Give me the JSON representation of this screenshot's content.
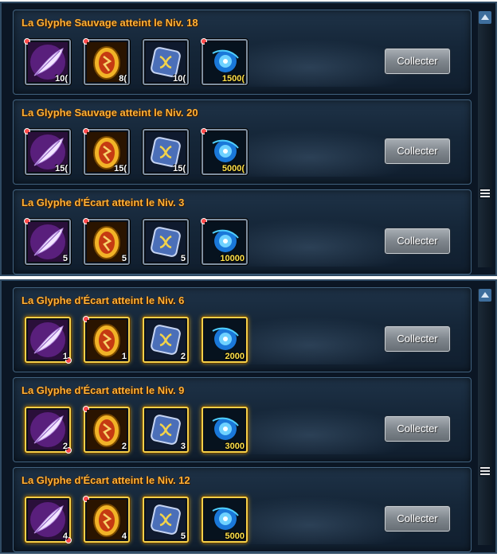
{
  "collect_label": "Collecter",
  "colors": {
    "title": "#ffb238",
    "panel_bg": "#0b1624",
    "button": "#7f868d",
    "energy_qty": "#ffe14a"
  },
  "icons": {
    "feather": "feather-icon",
    "egg": "egg-icon",
    "rune": "rune-icon",
    "energy": "energy-orb-icon"
  },
  "panels": [
    {
      "rows": [
        {
          "title": "La Glyphe Sauvage atteint le Niv. 18",
          "items": [
            "10(",
            "8(",
            "10(",
            "1500("
          ]
        },
        {
          "title": "La Glyphe Sauvage atteint le Niv. 20",
          "items": [
            "15(",
            "15(",
            "15(",
            "5000("
          ]
        },
        {
          "title": "La Glyphe d'Écart atteint le Niv. 3",
          "items": [
            "5",
            "5",
            "5",
            "10000"
          ]
        }
      ]
    },
    {
      "rows": [
        {
          "title": "La Glyphe d'Écart atteint le Niv. 6",
          "items": [
            "1",
            "1",
            "2",
            "2000"
          ]
        },
        {
          "title": "La Glyphe d'Écart atteint le Niv. 9",
          "items": [
            "2",
            "2",
            "3",
            "3000"
          ]
        },
        {
          "title": "La Glyphe d'Écart atteint le Niv. 12",
          "items": [
            "4",
            "4",
            "5",
            "5000"
          ]
        }
      ]
    }
  ]
}
